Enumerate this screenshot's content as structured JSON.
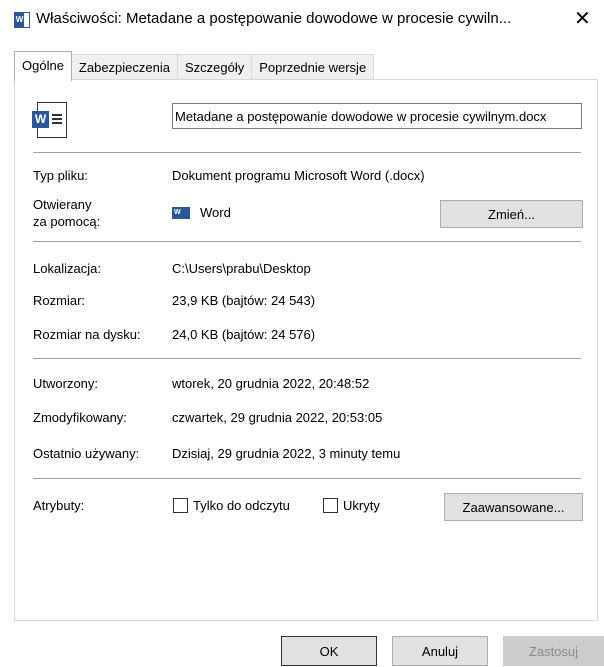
{
  "window": {
    "title": "Właściwości: Metadane a postępowanie dowodowe w procesie cywiln...",
    "close": "✕"
  },
  "tabs": [
    {
      "label": "Ogólne",
      "active": true
    },
    {
      "label": "Zabezpieczenia"
    },
    {
      "label": "Szczegóły"
    },
    {
      "label": "Poprzednie wersje"
    }
  ],
  "file": {
    "name": "Metadane a postępowanie dowodowe w procesie cywilnym.docx",
    "icon": "word-document-icon"
  },
  "type": {
    "label": "Typ pliku:",
    "value": "Dokument programu Microsoft Word (.docx)"
  },
  "opens_with": {
    "label_line1": "Otwierany",
    "label_line2": "za pomocą:",
    "app": "Word",
    "change_button": "Zmień..."
  },
  "location": {
    "label": "Lokalizacja:",
    "value": "C:\\Users\\prabu\\Desktop"
  },
  "size": {
    "label": "Rozmiar:",
    "value": "23,9 KB (bajtów: 24 543)"
  },
  "size_on_disk": {
    "label": "Rozmiar na dysku:",
    "value": "24,0 KB (bajtów: 24 576)"
  },
  "created": {
    "label": "Utworzony:",
    "value": "wtorek, 20 grudnia 2022, 20:48:52"
  },
  "modified": {
    "label": "Zmodyfikowany:",
    "value": "czwartek, 29 grudnia 2022, 20:53:05"
  },
  "accessed": {
    "label": "Ostatnio używany:",
    "value": "Dzisiaj, 29 grudnia 2022, 3 minuty temu"
  },
  "attributes": {
    "label": "Atrybuty:",
    "readonly": "Tylko do odczytu",
    "hidden": "Ukryty",
    "advanced_button": "Zaawansowane..."
  },
  "buttons": {
    "ok": "OK",
    "cancel": "Anuluj",
    "apply": "Zastosuj"
  },
  "colors": {
    "accent": "#2b579a",
    "apply_disabled_text": "#8a8a8a"
  }
}
